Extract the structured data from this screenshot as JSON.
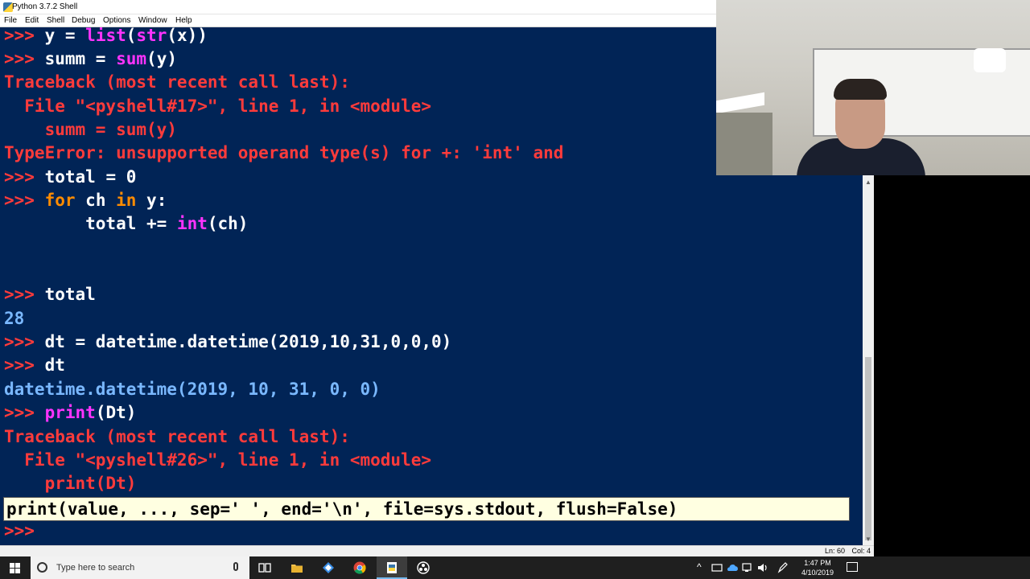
{
  "window": {
    "title": "Python 3.7.2 Shell",
    "menu": [
      "File",
      "Edit",
      "Shell",
      "Debug",
      "Options",
      "Window",
      "Help"
    ]
  },
  "shell": {
    "prompt": ">>>",
    "l1_a": "y = ",
    "l1_b": "list",
    "l1_c": "(",
    "l1_d": "str",
    "l1_e": "(x))",
    "l2_a": "summ = ",
    "l2_b": "sum",
    "l2_c": "(y)",
    "l3": "Traceback (most recent call last):",
    "l4": "  File \"<pyshell#17>\", line 1, in <module>",
    "l5": "    summ = sum(y)",
    "l6": "TypeError: unsupported operand type(s) for +: 'int' and",
    "l7": "total = 0",
    "l8_a": "for",
    "l8_b": " ch ",
    "l8_c": "in",
    "l8_d": " y:",
    "l9_a": "        total += ",
    "l9_b": "int",
    "l9_c": "(ch)",
    "l10": "total",
    "l11": "28",
    "l12": "dt = datetime.datetime(2019,10,31,0,0,0)",
    "l13": "dt",
    "l14": "datetime.datetime(2019, 10, 31, 0, 0)",
    "l15_a": "print",
    "l15_b": "(Dt)",
    "l16": "Traceback (most recent call last):",
    "l17": "  File \"<pyshell#26>\", line 1, in <module>",
    "l18": "    print(Dt)",
    "calltip": "print(value, ..., sep=' ', end='\\n', file=sys.stdout, flush=False)"
  },
  "status": {
    "ln": "Ln: 60",
    "col": "Col: 4"
  },
  "taskbar": {
    "search_placeholder": "Type here to search",
    "time": "1:47 PM",
    "date": "4/10/2019",
    "apps": [
      "task-view-icon",
      "file-explorer-icon",
      "app-diamond-icon",
      "chrome-icon",
      "python-idle-icon",
      "obs-icon"
    ]
  },
  "colors": {
    "shell_bg": "#012456",
    "prompt": "#ff3b3b",
    "builtin": "#ff33ff",
    "keyword": "#ff8c00",
    "output": "#7ab8ff",
    "calltip_bg": "#ffffe1"
  }
}
